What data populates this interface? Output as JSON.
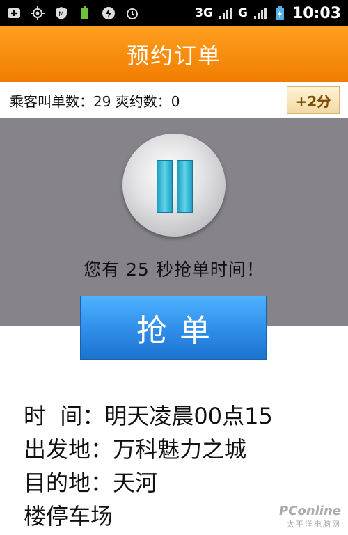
{
  "statusbar": {
    "net1": "3G",
    "net2": "G",
    "time": "10:03",
    "icons": [
      "plus-icon",
      "gps-icon",
      "shield-m-icon",
      "battery-app-icon",
      "lightning-icon",
      "alarm-icon",
      "3g-signal-icon",
      "g-signal-icon",
      "battery-icon"
    ]
  },
  "header": {
    "title": "预约订单"
  },
  "info": {
    "text": "乘客叫单数：29  爽约数：0",
    "bonus": "+2分"
  },
  "countdown": {
    "text": "您有 25 秒抢单时间！"
  },
  "grab_button": {
    "label": "抢单"
  },
  "order": {
    "time_label": "时  间：",
    "time_value": "明天凌晨00点15",
    "from_label": "出发地：",
    "from_value": "万科魅力之城",
    "to_label": "目的地：",
    "to_value": "天河",
    "to_value_cont": "楼停车场"
  },
  "watermark": {
    "logo": "PConline",
    "sub": "太平洋电脑网"
  }
}
